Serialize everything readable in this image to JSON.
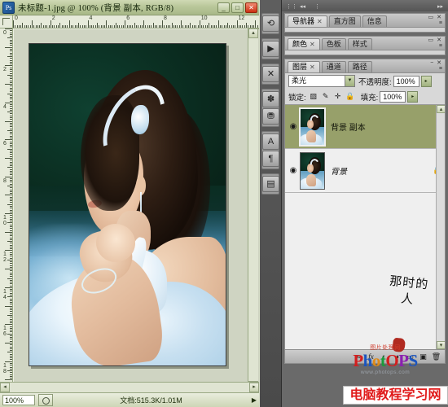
{
  "document_window": {
    "title": "未标题-1.jpg @ 100% (背景 副本, RGB/8)",
    "app_icon": "photoshop-icon",
    "window_buttons": {
      "minimize": "_",
      "maximize": "□",
      "close": "✕"
    },
    "rulers": {
      "horizontal_ticks": [
        "0",
        "2",
        "4",
        "6",
        "8",
        "10",
        "12"
      ],
      "vertical_ticks": [
        "0",
        "2",
        "4",
        "6",
        "8",
        "10",
        "12",
        "14",
        "16",
        "18"
      ]
    }
  },
  "status_bar": {
    "zoom": "100%",
    "thumb_icon": "proxy-preview-icon",
    "doc_info": "文档:515.3K/1.01M",
    "arrow": "▶"
  },
  "dock_icons": [
    {
      "name": "history-icon",
      "glyph": "⟲"
    },
    {
      "name": "actions-icon",
      "glyph": "▶"
    },
    {
      "name": "tool-presets-icon",
      "glyph": "✕"
    },
    {
      "name": "brushes-icon",
      "glyph": "✽"
    },
    {
      "name": "clone-source-icon",
      "glyph": "⛃"
    },
    {
      "name": "character-icon",
      "glyph": "A"
    },
    {
      "name": "paragraph-icon",
      "glyph": "¶"
    },
    {
      "name": "layer-comps-icon",
      "glyph": "▤"
    }
  ],
  "panels": [
    {
      "id": "navigator",
      "tabs": [
        "导航器",
        "直方图",
        "信息"
      ],
      "active_index": 0,
      "collapse_glyph": "▭",
      "close_glyph": "✕",
      "menu_glyph": "≡"
    },
    {
      "id": "color",
      "tabs": [
        "颜色",
        "色板",
        "样式"
      ],
      "active_index": 0,
      "collapse_glyph": "▭",
      "close_glyph": "✕",
      "menu_glyph": "≡"
    },
    {
      "id": "layers",
      "tabs": [
        "图层",
        "通道",
        "路径"
      ],
      "active_index": 0,
      "collapse_glyph": "−",
      "close_glyph": "✕",
      "menu_glyph": "≡"
    }
  ],
  "layers_panel": {
    "blend_mode": "柔光",
    "blend_dropdown_glyph": "▼",
    "opacity_label": "不透明度:",
    "opacity_value": "100%",
    "opacity_stepper_glyph": "▸",
    "lock_label": "锁定:",
    "lock_icons": [
      {
        "name": "lock-transparency-icon",
        "glyph": "▨"
      },
      {
        "name": "lock-image-icon",
        "glyph": "✎"
      },
      {
        "name": "lock-position-icon",
        "glyph": "✛"
      },
      {
        "name": "lock-all-icon",
        "glyph": "🔒"
      }
    ],
    "fill_label": "填充:",
    "fill_value": "100%",
    "fill_stepper_glyph": "▸",
    "layers": [
      {
        "name": "背景 副本",
        "visible": true,
        "eye_glyph": "◉",
        "selected": true,
        "locked": false,
        "lock_glyph": ""
      },
      {
        "name": "背景",
        "visible": true,
        "eye_glyph": "◉",
        "selected": false,
        "locked": true,
        "lock_glyph": "🔒"
      }
    ],
    "bottom_buttons": [
      {
        "name": "link-layers-button",
        "glyph": "∞"
      },
      {
        "name": "layer-style-fx-button",
        "glyph": "fx"
      },
      {
        "name": "layer-mask-button",
        "glyph": "◐"
      },
      {
        "name": "adjustment-layer-button",
        "glyph": "◑"
      },
      {
        "name": "new-group-button",
        "glyph": "▭"
      },
      {
        "name": "new-layer-button",
        "glyph": "▣"
      },
      {
        "name": "delete-layer-button",
        "glyph": "🗑"
      }
    ]
  },
  "watermarks": {
    "calligraphy": "那时的人",
    "photops_sub": "图片处理网",
    "photops_letters": [
      "P",
      "h",
      "o",
      "t",
      "O",
      "P",
      "S"
    ],
    "photops_url": "www.photops.com",
    "bottom_banner": "电脑教程学习网"
  },
  "colors": {
    "title_bar": "#b9c79a",
    "selected_layer": "#97a06a",
    "banner_text": "#e01b1b",
    "panel_bg": "#d4d4d4"
  }
}
